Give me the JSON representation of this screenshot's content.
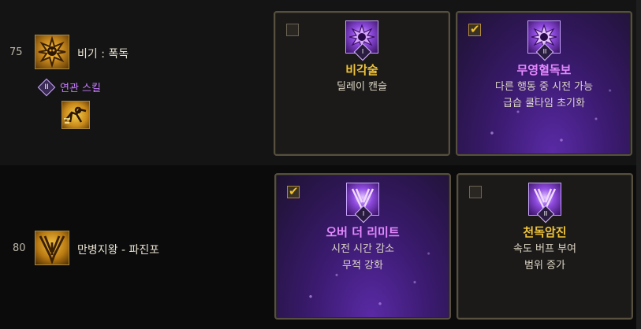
{
  "skills": [
    {
      "level": "75",
      "name": "비기 : 폭독",
      "related_label": "연관 스킬",
      "related_numeral": "II",
      "options": [
        {
          "numeral": "I",
          "title": "비각술",
          "desc": [
            "딜레이 캔슬"
          ],
          "checked": false
        },
        {
          "numeral": "II",
          "title": "무영혈독보",
          "desc": [
            "다른 행동 중 시전 가능",
            "급습 쿨타임 초기화"
          ],
          "checked": true
        }
      ]
    },
    {
      "level": "80",
      "name": "만병지왕 - 파진포",
      "options": [
        {
          "numeral": "I",
          "title": "오버 더 리미트",
          "desc": [
            "시전 시간 감소",
            "무적 강화"
          ],
          "checked": true
        },
        {
          "numeral": "II",
          "title": "천독암진",
          "desc": [
            "속도 버프 부여",
            "범위 증가"
          ],
          "checked": false
        }
      ]
    }
  ],
  "icons": {
    "skill1": "skull-emblem-icon",
    "skill2": "claw-slash-icon",
    "related": "running-figure-icon",
    "option_a": "skull-emblem-icon",
    "option_b": "claw-slash-icon"
  },
  "colors": {
    "gold_title": "#f0c43a",
    "purple_title": "#e488ff",
    "related_label": "#c77dff",
    "checkmark": "#f0c030"
  }
}
